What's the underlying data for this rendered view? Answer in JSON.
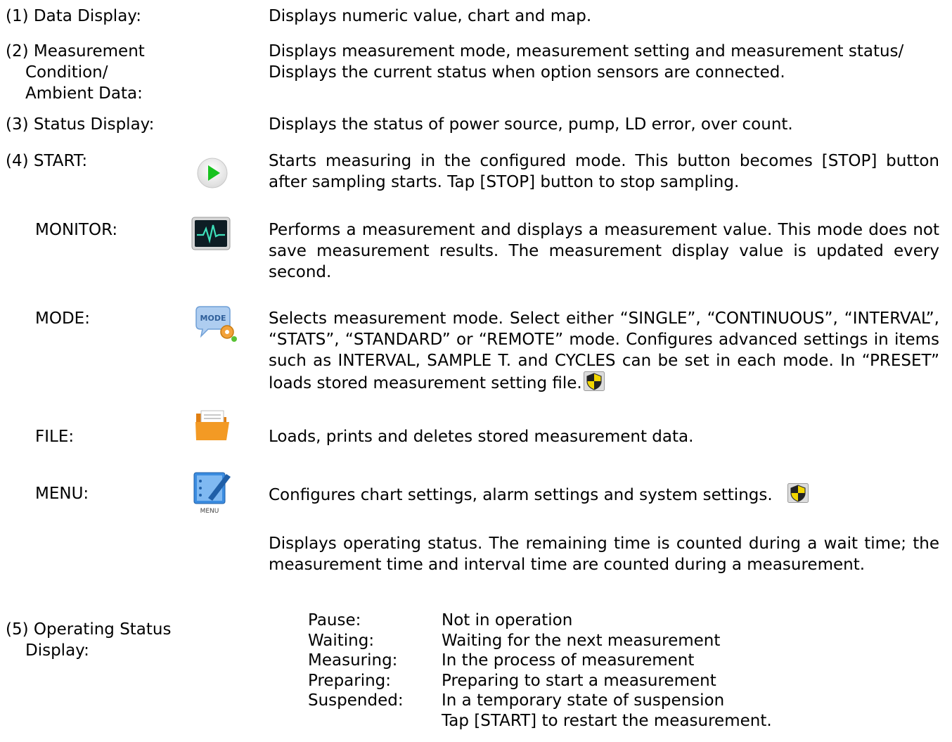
{
  "items": [
    {
      "label": "(1) Data Display:",
      "desc": "Displays numeric value, chart and map."
    },
    {
      "label_lines": [
        "(2) Measurement",
        "Condition/",
        "Ambient Data:"
      ],
      "desc_lines": [
        "Displays measurement mode, measurement setting and measurement status/",
        "Displays the current status when option sensors are connected."
      ]
    },
    {
      "label": "(3) Status Display:",
      "desc": "Displays the status of power source, pump, LD error, over count."
    },
    {
      "label": "(4) START:",
      "icon": "play-icon",
      "desc": "Starts measuring in the configured mode. This button becomes [STOP] button after sampling starts. Tap [STOP] button to stop sampling."
    },
    {
      "label": "MONITOR:",
      "icon": "monitor-waveform-icon",
      "desc": "Performs a measurement and displays a measurement value. This mode does not save measurement results. The measurement display value is updated every second."
    },
    {
      "label": "MODE:",
      "icon": "mode-settings-icon",
      "icon_text": "MODE",
      "desc": "Selects measurement mode. Select either “SINGLE”, “CONTINUOUS”, “INTERVAL”, “STATS”, “STANDARD” or “REMOTE” mode. Configures advanced settings in items such as INTERVAL, SAMPLE T. and CYCLES can be set in each mode. In “PRESET” loads stored measurement setting file.",
      "badge": "security-shield-icon"
    },
    {
      "label": "FILE:",
      "icon": "folder-icon",
      "desc": "Loads, prints and deletes stored measurement data."
    },
    {
      "label": "MENU:",
      "icon": "menu-icon",
      "icon_text": "MENU",
      "desc": "Configures chart settings, alarm settings and system settings.",
      "badge": "security-shield-icon"
    },
    {
      "label_lines": [
        "(5) Operating Status",
        "Display:"
      ],
      "desc": "Displays operating status.   The remaining time is counted during a wait time; the measurement time and interval time are counted during a measurement.",
      "statuses": [
        {
          "key": "Pause:",
          "value": "Not in operation"
        },
        {
          "key": "Waiting:",
          "value": "Waiting for the next measurement"
        },
        {
          "key": "Measuring:",
          "value": "In the process of measurement"
        },
        {
          "key": "Preparing:",
          "value": "Preparing to start a measurement"
        },
        {
          "key": "Suspended:",
          "value": "In a temporary state of suspension"
        }
      ],
      "status_note": "Tap [START] to restart the measurement."
    }
  ],
  "colors": {
    "play_green": "#17c21f",
    "shield_yellow": "#f2d600",
    "folder_orange": "#f39a24",
    "menu_blue": "#2f7fd6"
  }
}
